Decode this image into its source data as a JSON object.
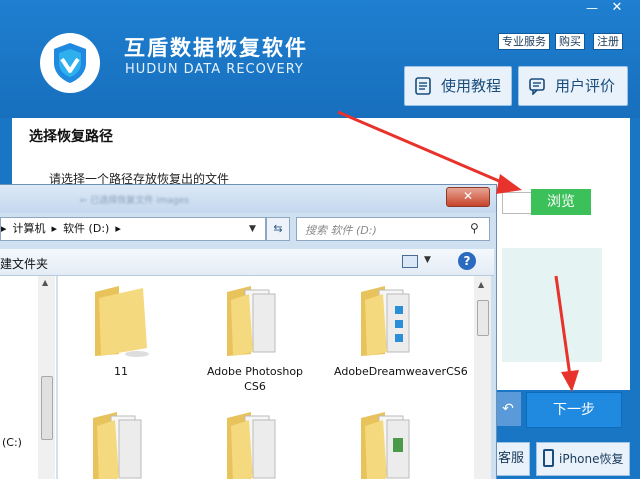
{
  "app": {
    "title": "互盾数据恢复软件",
    "subtitle": "HUDUN DATA RECOVERY",
    "links": {
      "service": "专业服务",
      "buy": "购买",
      "register": "注册"
    },
    "buttons": {
      "tutorial": "使用教程",
      "review": "用户评价"
    },
    "section_title": "选择恢复路径",
    "path_prompt": "请选择一个路径存放恢复出的文件",
    "browse": "浏览",
    "next": "下一步",
    "support": "客服",
    "iphone": "iPhone恢复",
    "colors": {
      "header": "#1976c5",
      "browse": "#3cc05a",
      "next": "#1f8ae0",
      "arrow": "#e8322c"
    }
  },
  "dialog": {
    "title_blurred": "← 已选择恢复文件 images",
    "address": [
      "计算机",
      "软件 (D:)"
    ],
    "search_placeholder": "搜索 软件 (D:)",
    "new_folder": "建文件夹",
    "nav_drive": "(C:)",
    "files": [
      {
        "name": "11",
        "kind": "plain"
      },
      {
        "name": "Adobe Photoshop CS6",
        "kind": "docs"
      },
      {
        "name": "AdobeDreamweaverCS6",
        "kind": "blue"
      },
      {
        "name": "",
        "kind": "docs"
      },
      {
        "name": "",
        "kind": "docs"
      },
      {
        "name": "",
        "kind": "green"
      }
    ]
  }
}
